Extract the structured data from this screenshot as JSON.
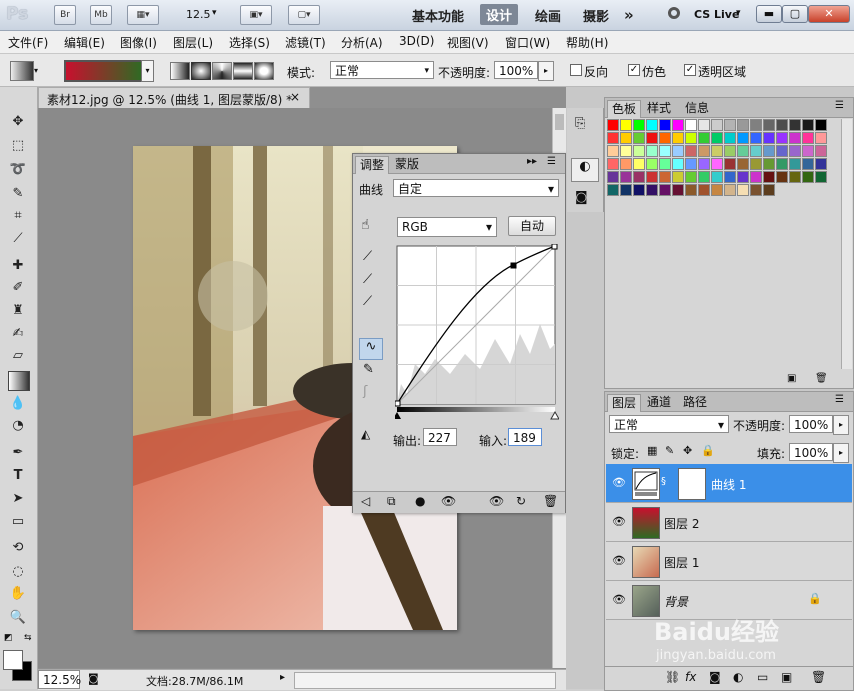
{
  "appbar": {
    "logo": "Ps",
    "br": "Br",
    "mb": "Mb",
    "zoom": "12.5",
    "workspaces": [
      "基本功能",
      "设计",
      "绘画",
      "摄影"
    ],
    "active_workspace": "设计",
    "more": "»",
    "cslive": "CS Live"
  },
  "menu": [
    "文件(F)",
    "编辑(E)",
    "图像(I)",
    "图层(L)",
    "选择(S)",
    "滤镜(T)",
    "分析(A)",
    "3D(D)",
    "视图(V)",
    "窗口(W)",
    "帮助(H)"
  ],
  "options": {
    "mode_label": "模式:",
    "mode_value": "正常",
    "opacity_label": "不透明度:",
    "opacity_value": "100%",
    "reverse": "反向",
    "dither": "仿色",
    "transparency": "透明区域",
    "gradient_colors": [
      "#c8102e",
      "#2e6b23"
    ]
  },
  "document": {
    "tab_title": "素材12.jpg @ 12.5% (曲线 1, 图层蒙版/8) *",
    "close": "×"
  },
  "status": {
    "zoom": "12.5%",
    "doc_info": "文档:28.7M/86.1M"
  },
  "adjust_panel": {
    "tab_adjust": "调整",
    "tab_mask": "蒙版",
    "curve_label": "曲线",
    "preset": "自定",
    "channel": "RGB",
    "auto_button": "自动",
    "output_label": "输出:",
    "output_value": "227",
    "input_label": "输入:",
    "input_value": "189"
  },
  "swatch_panel": {
    "tabs": [
      "色板",
      "样式",
      "信息"
    ],
    "active": "色板"
  },
  "layers_panel": {
    "tabs": [
      "图层",
      "通道",
      "路径"
    ],
    "active": "图层",
    "blend": "正常",
    "opacity_label": "不透明度:",
    "opacity_value": "100%",
    "lock_label": "锁定:",
    "fill_label": "填充:",
    "fill_value": "100%",
    "layers": [
      {
        "name": "曲线 1",
        "selected": true
      },
      {
        "name": "图层 2",
        "selected": false
      },
      {
        "name": "图层 1",
        "selected": false
      },
      {
        "name": "背景",
        "selected": false
      }
    ]
  },
  "watermark": {
    "line1": "Baidu经验",
    "line2": "jingyan.baidu.com"
  }
}
